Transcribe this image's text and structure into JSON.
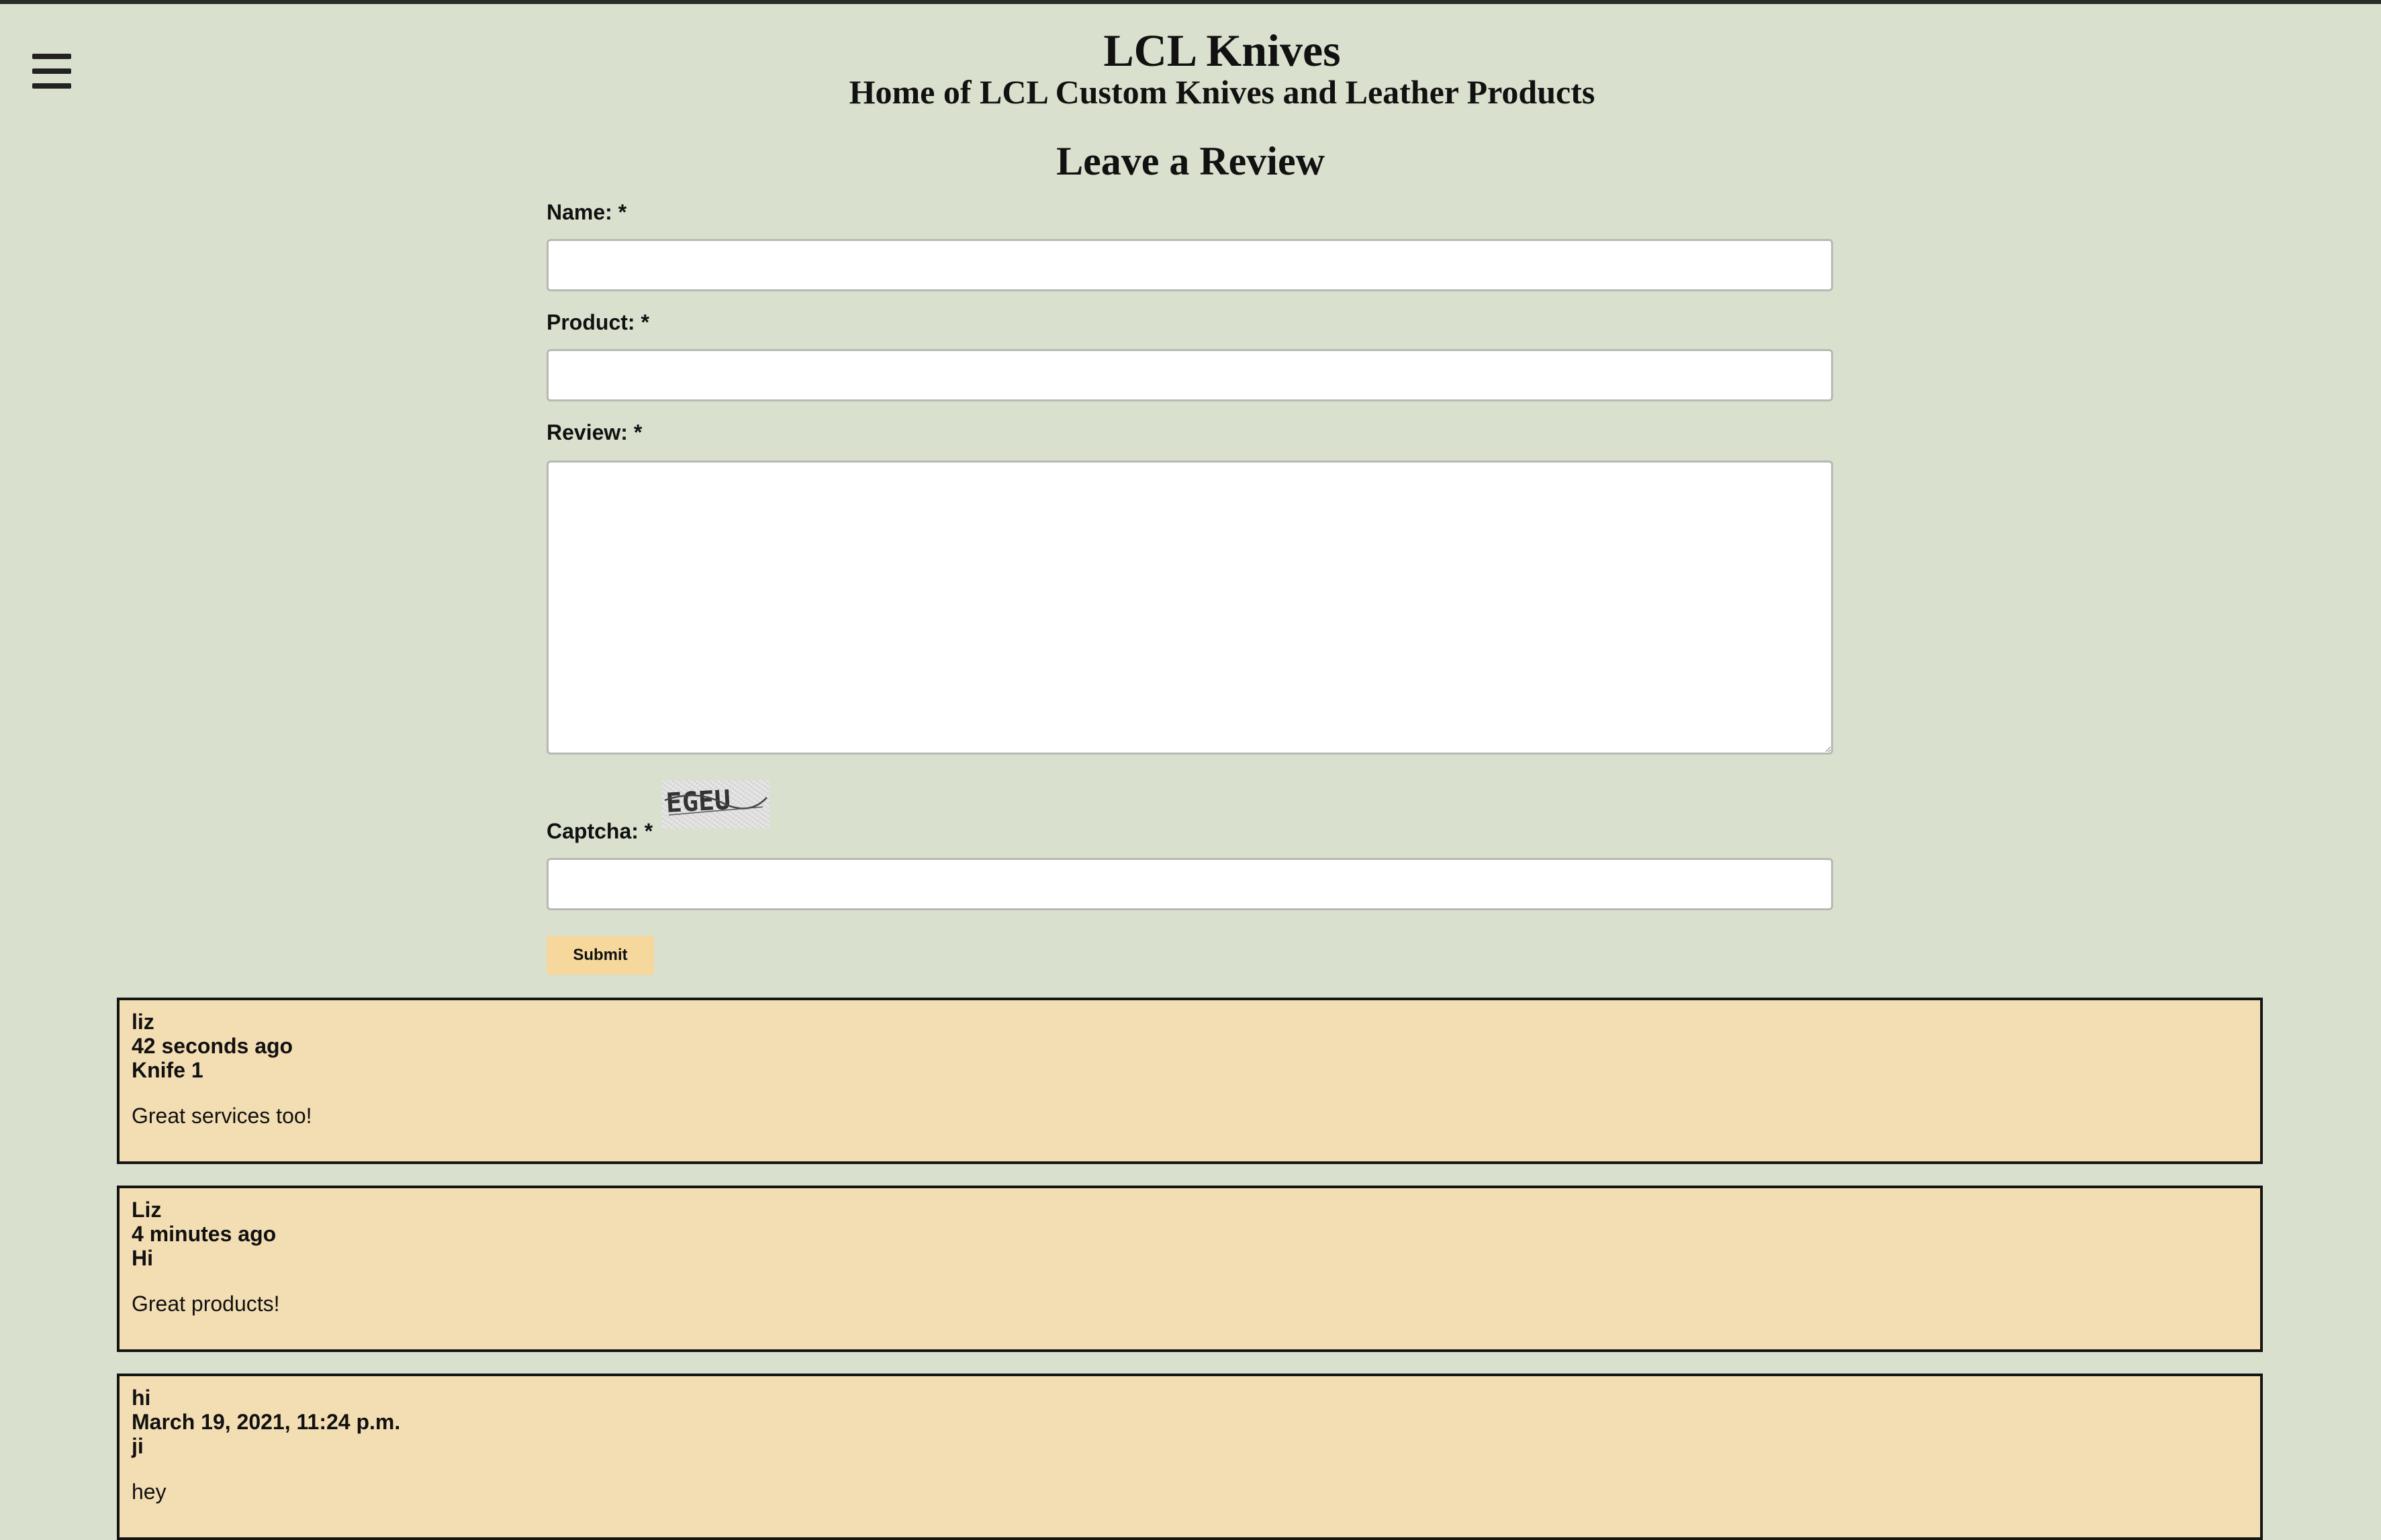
{
  "header": {
    "menu_icon": "hamburger-menu-icon",
    "site_title": "LCL Knives",
    "site_subtitle": "Home of LCL Custom Knives and Leather Products"
  },
  "form": {
    "title": "Leave a Review",
    "name_label": "Name: *",
    "name_value": "",
    "product_label": "Product: *",
    "product_value": "",
    "review_label": "Review: *",
    "review_value": "",
    "captcha_label": "Captcha: *",
    "captcha_image_text": "EGEU",
    "captcha_value": "",
    "submit_label": "Submit"
  },
  "reviews": [
    {
      "name": "liz",
      "time": "42 seconds ago",
      "product": "Knife 1",
      "text": "Great services too!"
    },
    {
      "name": "Liz",
      "time": "4 minutes ago",
      "product": "Hi",
      "text": "Great products!"
    },
    {
      "name": "hi",
      "time": "March 19, 2021, 11:24 p.m.",
      "product": "ji",
      "text": "hey"
    }
  ],
  "colors": {
    "page_background": "#d9e0ce",
    "card_background": "#f3deb3",
    "submit_background": "#f6d89c",
    "card_border": "#141414"
  }
}
